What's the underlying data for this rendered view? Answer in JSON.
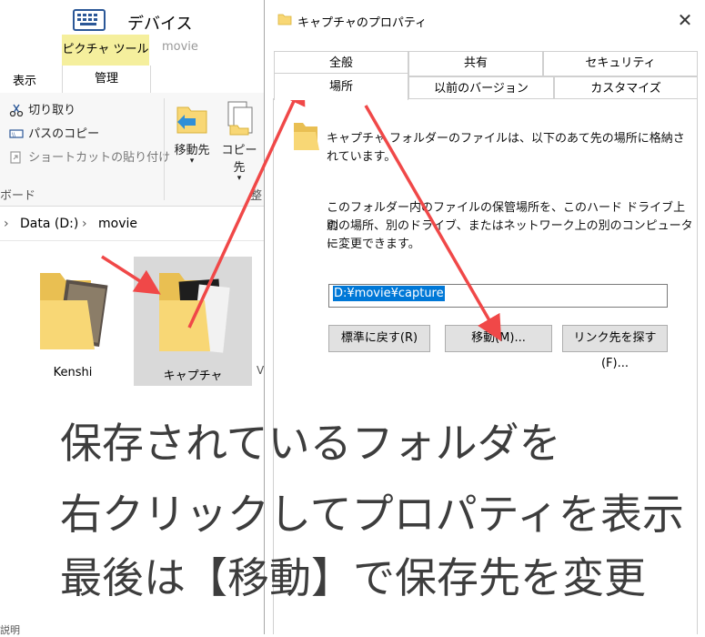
{
  "explorer": {
    "window_title": "デバイス",
    "ribbon_context_tab": "ピクチャ ツール",
    "ribbon_context_subtab": "管理",
    "folder_tab_title": "movie",
    "view_tab": "表示",
    "clipboard": {
      "cut": "切り取り",
      "copy_path": "パスのコピー",
      "paste_shortcut": "ショートカットの貼り付け",
      "group_label": "ボード"
    },
    "organize": {
      "move_to": "移動先",
      "copy_to": "コピー先",
      "group_label_partial": "整"
    },
    "address": {
      "drive": "Data (D:)",
      "folder": "movie"
    },
    "folders": [
      {
        "name": "Kenshi"
      },
      {
        "name": "キャプチャ",
        "selected": true
      }
    ],
    "bottom_partial": "説明"
  },
  "dialog": {
    "title": "キャプチャのプロパティ",
    "close_label": "✕",
    "tabs_row1": [
      "全般",
      "共有",
      "セキュリティ"
    ],
    "tabs_row2": [
      "場所",
      "以前のバージョン",
      "カスタマイズ"
    ],
    "active_tab": "場所",
    "description_line1": "キャプチャ フォルダーのファイルは、以下のあて先の場所に格納さ",
    "description_line2": "れています。",
    "info_line1": "このフォルダー内のファイルの保管場所を、このハード ドライブ上の",
    "info_line2": "別の場所、別のドライブ、またはネットワーク上の別のコンピューター",
    "info_line3": "に変更できます。",
    "path_value": "D:¥movie¥capture",
    "buttons": {
      "restore_default": "標準に戻す(R)",
      "move": "移動(M)...",
      "find_target": "リンク先を探す(F)..."
    }
  },
  "caption": {
    "line1": "保存されているフォルダを",
    "line2": "右クリックしてプロパティを表示",
    "line3": "最後は【移動】で保存先を変更"
  },
  "colors": {
    "arrow": "#f04848",
    "context_tab": "#f5ef9d",
    "selection_blue": "#0078d7",
    "folder": "#f8d775",
    "caption_text": "#3d3d3d"
  }
}
